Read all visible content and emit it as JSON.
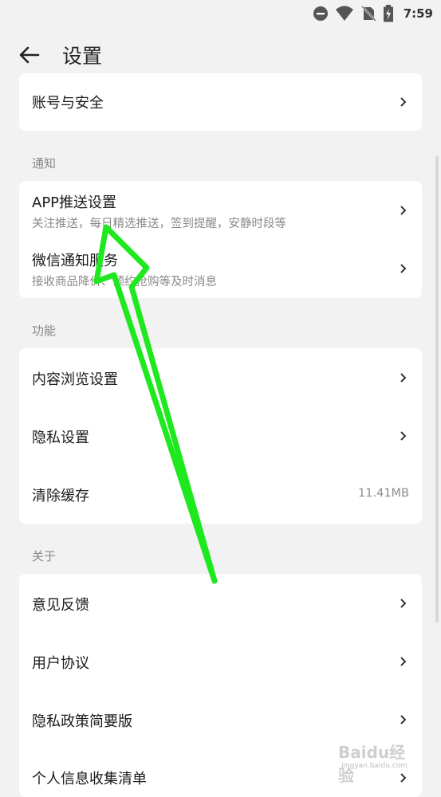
{
  "status": {
    "time": "7:59"
  },
  "header": {
    "title": "设置"
  },
  "account": {
    "label": "账号与安全"
  },
  "notify": {
    "header": "通知",
    "items": [
      {
        "label": "APP推送设置",
        "sub": "关注推送，每日精选推送，签到提醒，安静时段等"
      },
      {
        "label": "微信通知服务",
        "sub": "接收商品降价、预约抢购等及时消息"
      }
    ]
  },
  "features": {
    "header": "功能",
    "items": [
      {
        "label": "内容浏览设置"
      },
      {
        "label": "隐私设置"
      },
      {
        "label": "清除缓存",
        "value": "11.41MB"
      }
    ]
  },
  "about": {
    "header": "关于",
    "items": [
      {
        "label": "意见反馈"
      },
      {
        "label": "用户协议"
      },
      {
        "label": "隐私政策简要版"
      },
      {
        "label": "个人信息收集清单"
      }
    ]
  },
  "annotation": {
    "color": "#1ee81e"
  },
  "watermark": {
    "brand": "Baidu经验",
    "url": "jingyan.baidu.com"
  }
}
